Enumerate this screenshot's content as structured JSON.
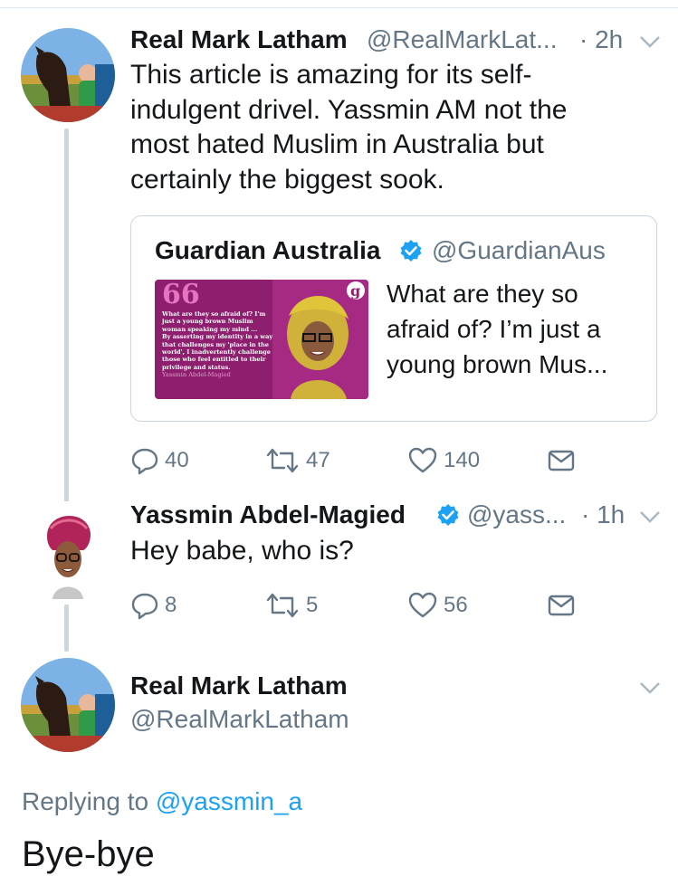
{
  "tweet1": {
    "name": "Real Mark Latham",
    "handle": "@RealMarkLat...",
    "time": "· 2h",
    "text_lines": [
      "This article is amazing for its self-",
      "indulgent drivel. Yassmin AM not the",
      "most hated Muslim in Australia but",
      "certainly the biggest sook."
    ],
    "quote": {
      "name": "Guardian Australia",
      "handle": "@GuardianAus",
      "text_lines": [
        "What are they so",
        "afraid of? I’m just a",
        "young brown Mus..."
      ],
      "image_quote_lines": [
        "What are they so afraid of? I'm",
        "just a young brown Muslim",
        "woman speaking my mind ...",
        "By asserting my identity in a way",
        "that challenges my 'place in the",
        "world', I inadvertently challenge",
        "those who feel entitled to their",
        "privilege and status."
      ],
      "image_attribution": "Yassmin Abdel-Magied",
      "image_logo": "g"
    },
    "actions": {
      "replies": "40",
      "retweets": "47",
      "likes": "140"
    }
  },
  "tweet2": {
    "name": "Yassmin Abdel-Magied",
    "handle": "@yass...",
    "time": "· 1h",
    "text": "Hey babe, who is?",
    "actions": {
      "replies": "8",
      "retweets": "5",
      "likes": "56"
    }
  },
  "tweet3": {
    "name": "Real Mark Latham",
    "handle": "@RealMarkLatham",
    "replying_prefix": "Replying to ",
    "replying_to": "@yassmin_a",
    "text": "Bye-bye"
  },
  "colors": {
    "accent": "#1da1f2",
    "muted": "#657786",
    "quote_bg": "#8e1f6f"
  },
  "icons": [
    "reply-icon",
    "retweet-icon",
    "like-icon",
    "dm-icon",
    "chevron-down-icon",
    "verified-badge-icon"
  ]
}
